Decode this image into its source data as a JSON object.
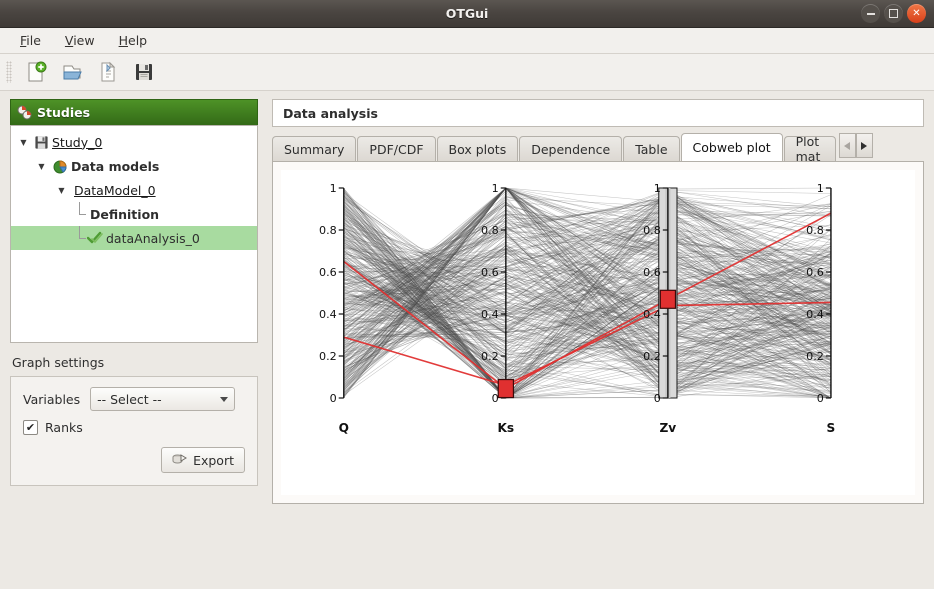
{
  "window": {
    "title": "OTGui",
    "controls": [
      {
        "name": "minimize",
        "glyph": "–"
      },
      {
        "name": "maximize",
        "glyph": "□"
      },
      {
        "name": "close",
        "glyph": "✕"
      }
    ]
  },
  "menu": {
    "items": [
      {
        "label": "File",
        "mnemonic": "F"
      },
      {
        "label": "View",
        "mnemonic": "V"
      },
      {
        "label": "Help",
        "mnemonic": "H"
      }
    ]
  },
  "toolbar": {
    "buttons": [
      {
        "name": "new-study-icon",
        "tip": "New"
      },
      {
        "name": "open-study-icon",
        "tip": "Open"
      },
      {
        "name": "import-script-icon",
        "tip": "Import"
      },
      {
        "name": "save-study-icon",
        "tip": "Save"
      }
    ]
  },
  "sidebar": {
    "header": {
      "label": "Studies",
      "icon": "studies-icon"
    },
    "tree": [
      {
        "label": "Study_0",
        "icon": "floppy-icon",
        "depth": 0,
        "expanded": true,
        "style": "link",
        "selected": false
      },
      {
        "label": "Data models",
        "icon": "pie-icon",
        "depth": 1,
        "expanded": true,
        "style": "bold",
        "selected": false
      },
      {
        "label": "DataModel_0",
        "icon": "",
        "depth": 2,
        "expanded": true,
        "style": "link",
        "selected": false
      },
      {
        "label": "Definition",
        "icon": "",
        "depth": 3,
        "expanded": false,
        "style": "bold",
        "selected": false
      },
      {
        "label": "dataAnalysis_0",
        "icon": "check-icon",
        "depth": 3,
        "expanded": false,
        "style": "plain",
        "selected": true
      }
    ]
  },
  "graph_settings": {
    "title": "Graph settings",
    "variables_label": "Variables",
    "variables_value": "-- Select --",
    "variables_options": [
      "-- Select --"
    ],
    "ranks_label": "Ranks",
    "ranks_checked": true,
    "ranks_glyph": "✔",
    "export_label": "Export",
    "export_icon": "export-icon"
  },
  "main": {
    "header_title": "Data analysis",
    "tabs": [
      {
        "label": "Summary",
        "active": false
      },
      {
        "label": "PDF/CDF",
        "active": false
      },
      {
        "label": "Box plots",
        "active": false
      },
      {
        "label": "Dependence",
        "active": false
      },
      {
        "label": "Table",
        "active": false
      },
      {
        "label": "Cobweb plot",
        "active": true
      },
      {
        "label": "Plot mat",
        "active": false,
        "clipped": true
      }
    ],
    "tab_scroll": {
      "left": "◀",
      "right": "▶"
    }
  },
  "chart_data": {
    "type": "line",
    "subtype": "parallel-coordinates-cobweb",
    "title": "",
    "xlabel": "",
    "ylabel": "",
    "ylim": [
      0,
      1
    ],
    "ytick_labels": [
      "0",
      "0.2",
      "0.4",
      "0.6",
      "0.8",
      "1"
    ],
    "ytick_values": [
      0,
      0.2,
      0.4,
      0.6,
      0.8,
      1
    ],
    "grid": false,
    "legend": "none",
    "categories": [
      "Q",
      "Ks",
      "Zv",
      "S"
    ],
    "ranks": true,
    "n_lines": 400,
    "line_color": "#4d4d4d",
    "highlight_color": "#e03030",
    "sliders": [
      {
        "axis": "Ks",
        "value": 0.045,
        "track": false
      },
      {
        "axis": "Zv",
        "value": 0.47,
        "track": true,
        "track_min": 0.0,
        "track_max": 1.0
      }
    ],
    "highlighted_series": [
      {
        "name": "highlight-1",
        "values": [
          0.65,
          0.045,
          0.47,
          0.88
        ]
      },
      {
        "name": "highlight-2",
        "values": [
          0.29,
          0.06,
          0.44,
          0.455
        ]
      }
    ]
  }
}
